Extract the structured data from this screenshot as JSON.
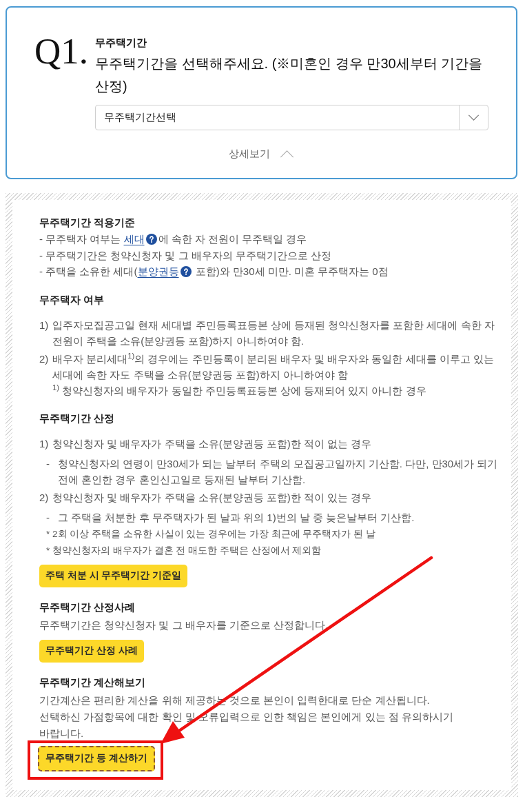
{
  "question": {
    "number": "Q1.",
    "label": "무주택기간",
    "text": "무주택기간을 선택해주세요. (※미혼인 경우 만30세부터 기간을 산정)",
    "select": {
      "value": "무주택기간선택"
    },
    "details_toggle": {
      "label": "상세보기",
      "expanded": true
    }
  },
  "details": {
    "sections": [
      {
        "title": "무주택기간 적용기준",
        "blocks": [
          {
            "kind": "lines",
            "lines": [
              [
                {
                  "kind": "text",
                  "text": "- 무주택자 여부는 "
                },
                {
                  "kind": "link",
                  "text": "세대",
                  "help": true
                },
                {
                  "kind": "text",
                  "text": "에 속한 자 전원이 무주택일 경우"
                }
              ],
              [
                {
                  "kind": "text",
                  "text": "- 무주택기간은 청약신청자 및 그 배우자의 무주택기간으로 산정"
                }
              ],
              [
                {
                  "kind": "text",
                  "text": "- 주택을 소유한 세대("
                },
                {
                  "kind": "link",
                  "text": "분양권등",
                  "help": true
                },
                {
                  "kind": "text",
                  "text": " 포함)와 만30세 미만. 미혼 무주택자는 0점"
                }
              ]
            ]
          }
        ]
      },
      {
        "title": "무주택자 여부",
        "blocks": [
          {
            "kind": "list",
            "items": [
              {
                "marker": "1)",
                "text": "입주자모집공고일 현재 세대별 주민등록표등본 상에 등재된 청약신청자를 포함한 세대에 속한 자 전원이 주택을 소유(분양권등 포함)하지 아니하여야 함."
              },
              {
                "marker": "2)",
                "text": "배우자 분리세대$^{1)}$의 경우에는 주민등록이 분리된 배우자 및 배우자와 동일한 세대를 이루고 있는 세대에 속한 자도 주택을 소유(분양권등 포함)하지 아니하여야 함",
                "children": [
                  {
                    "kind": "footnote",
                    "text": "$^{1)}$ 청약신청자의 배우자가 동일한 주민등록표등본 상에 등재되어 있지 아니한 경우"
                  }
                ]
              }
            ]
          }
        ]
      },
      {
        "title": "무주택기간 산정",
        "blocks": [
          {
            "kind": "list",
            "items": [
              {
                "marker": "1)",
                "text": "청약신청자 및 배우자가 주택을 소유(분양권등 포함)한 적이 없는 경우",
                "children": [
                  {
                    "kind": "dash",
                    "marker": "-",
                    "text": "청약신청자의 연령이 만30세가 되는 날부터 주택의 모집공고일까지 기산함. 다만, 만30세가 되기 전에 혼인한 경우 혼인신고일로 등재된 날부터 기산함."
                  }
                ]
              },
              {
                "marker": "2)",
                "text": "청약신청자 및 배우자가 주택을 소유(분양권등 포함)한 적이 있는 경우",
                "children": [
                  {
                    "kind": "dash",
                    "marker": "-",
                    "text": "그 주택을 처분한 후 무주택자가 된 날과 위의 1)번의 날 중 늦은날부터 기산함."
                  },
                  {
                    "kind": "note",
                    "text": "* 2회 이상 주택을 소유한 사실이 있는 경우에는 가장 최근에 무주택자가 된 날"
                  },
                  {
                    "kind": "note",
                    "text": "* 청약신청자의 배우자가 결혼 전 매도한 주택은 산정에서 제외함"
                  }
                ]
              }
            ]
          },
          {
            "kind": "button",
            "label": "주택 처분 시 무주택기간 기준일",
            "focused": false,
            "highlighted": false
          }
        ]
      },
      {
        "title": "무주택기간 산정사례",
        "blocks": [
          {
            "kind": "paragraph",
            "lines": [
              "무주택기간은 청약신청자 및 그 배우자를 기준으로 산정합니다."
            ]
          },
          {
            "kind": "button",
            "label": "무주택기간 산정 사례",
            "focused": false,
            "highlighted": false
          }
        ]
      },
      {
        "title": "무주택기간 계산해보기",
        "blocks": [
          {
            "kind": "paragraph",
            "lines": [
              "기간계산은 편리한 계산을 위해 제공하는 것으로 본인이 입력한대로 단순 계산됩니다.",
              "선택하신 가점항목에 대한 확인 및 오류입력으로 인한 책임은 본인에게 있는 점 유의하시기 바랍니다."
            ]
          },
          {
            "kind": "button",
            "label": "무주택기간 등 계산하기",
            "focused": true,
            "highlighted": true
          }
        ]
      }
    ]
  }
}
